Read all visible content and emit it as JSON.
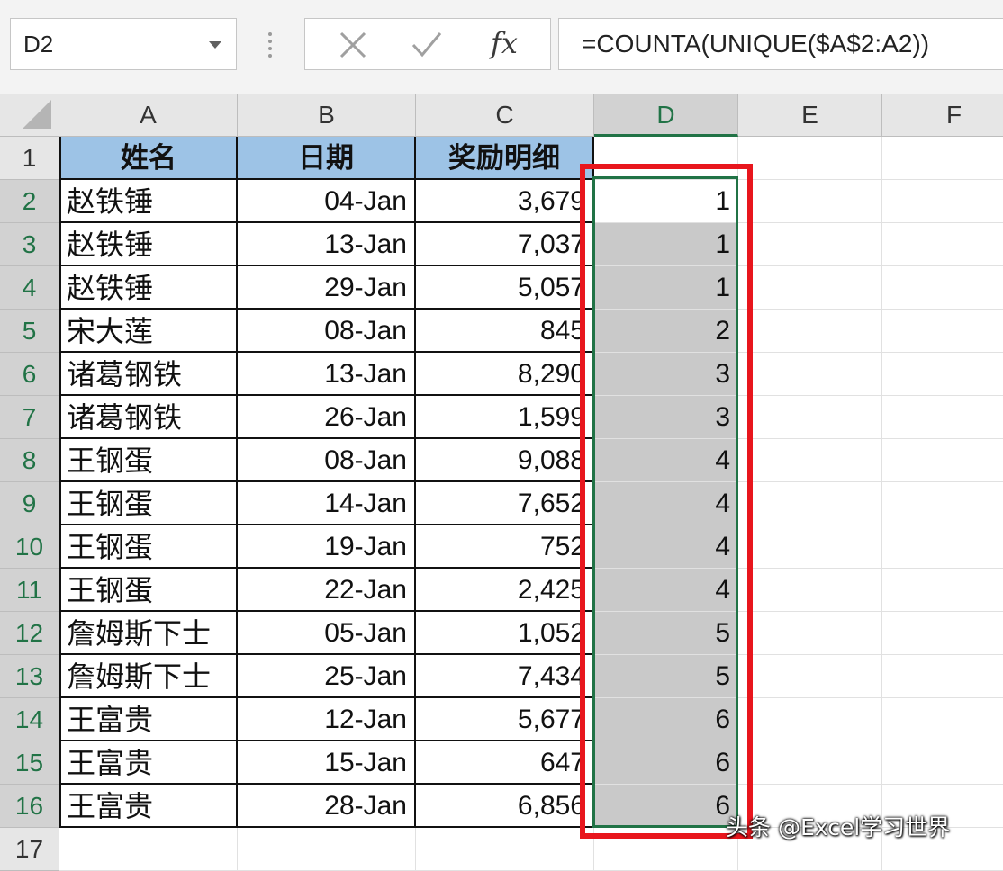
{
  "formula_bar": {
    "name_box": "D2",
    "cancel_icon": "x-icon",
    "enter_icon": "check-icon",
    "function_label": "fx",
    "formula": "=COUNTA(UNIQUE($A$2:A2))"
  },
  "columns": [
    "A",
    "B",
    "C",
    "D",
    "E",
    "F"
  ],
  "rows": [
    "1",
    "2",
    "3",
    "4",
    "5",
    "6",
    "7",
    "8",
    "9",
    "10",
    "11",
    "12",
    "13",
    "14",
    "15",
    "16",
    "17"
  ],
  "headers": [
    "姓名",
    "日期",
    "奖励明细"
  ],
  "table": [
    {
      "name": "赵铁锤",
      "date": "04-Jan",
      "amount": "3,679",
      "d": "1"
    },
    {
      "name": "赵铁锤",
      "date": "13-Jan",
      "amount": "7,037",
      "d": "1"
    },
    {
      "name": "赵铁锤",
      "date": "29-Jan",
      "amount": "5,057",
      "d": "1"
    },
    {
      "name": "宋大莲",
      "date": "08-Jan",
      "amount": "845",
      "d": "2"
    },
    {
      "name": "诸葛钢铁",
      "date": "13-Jan",
      "amount": "8,290",
      "d": "3"
    },
    {
      "name": "诸葛钢铁",
      "date": "26-Jan",
      "amount": "1,599",
      "d": "3"
    },
    {
      "name": "王钢蛋",
      "date": "08-Jan",
      "amount": "9,088",
      "d": "4"
    },
    {
      "name": "王钢蛋",
      "date": "14-Jan",
      "amount": "7,652",
      "d": "4"
    },
    {
      "name": "王钢蛋",
      "date": "19-Jan",
      "amount": "752",
      "d": "4"
    },
    {
      "name": "王钢蛋",
      "date": "22-Jan",
      "amount": "2,425",
      "d": "4"
    },
    {
      "name": "詹姆斯下士",
      "date": "05-Jan",
      "amount": "1,052",
      "d": "5"
    },
    {
      "name": "詹姆斯下士",
      "date": "25-Jan",
      "amount": "7,434",
      "d": "5"
    },
    {
      "name": "王富贵",
      "date": "12-Jan",
      "amount": "5,677",
      "d": "6"
    },
    {
      "name": "王富贵",
      "date": "15-Jan",
      "amount": "647",
      "d": "6"
    },
    {
      "name": "王富贵",
      "date": "28-Jan",
      "amount": "6,856",
      "d": "6"
    }
  ],
  "watermark": "头条 @Excel学习世界",
  "colors": {
    "header_fill": "#9dc3e6",
    "selection_fill": "#c9c9c9",
    "excel_green": "#217346",
    "highlight_red": "#e8161d"
  }
}
